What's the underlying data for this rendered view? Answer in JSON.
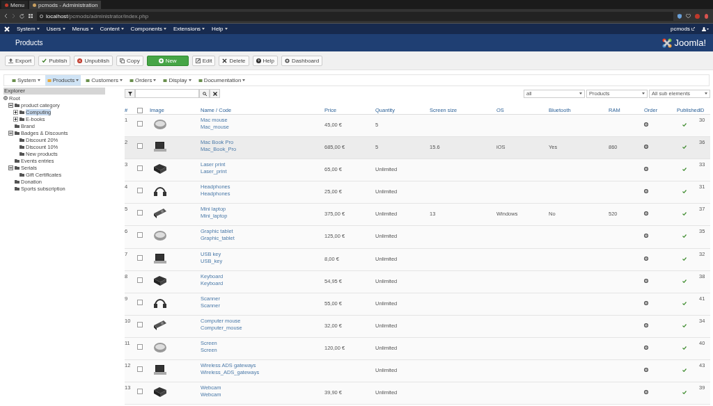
{
  "browser": {
    "tabs": [
      {
        "label": "Menu",
        "selected": false
      },
      {
        "label": "pcmods - Administration",
        "selected": true
      }
    ],
    "url_host": "localhost",
    "url_path": "/pcmods/administrator/index.php"
  },
  "nav": {
    "items": [
      "System",
      "Users",
      "Menus",
      "Content",
      "Components",
      "Extensions",
      "Help"
    ],
    "user": "pcmods"
  },
  "header": {
    "title": "Products",
    "logo": "Joomla!"
  },
  "toolbar": [
    {
      "label": "Export",
      "kind": "export"
    },
    {
      "label": "Publish",
      "kind": "publish"
    },
    {
      "label": "Unpublish",
      "kind": "unpublish"
    },
    {
      "label": "Copy",
      "kind": "copy"
    },
    {
      "label": "New",
      "kind": "new"
    },
    {
      "label": "Edit",
      "kind": "edit"
    },
    {
      "label": "Delete",
      "kind": "delete"
    },
    {
      "label": "Help",
      "kind": "help"
    },
    {
      "label": "Dashboard",
      "kind": "dashboard"
    }
  ],
  "submenu": [
    {
      "label": "System",
      "selected": false
    },
    {
      "label": "Products",
      "selected": true
    },
    {
      "label": "Customers",
      "selected": false
    },
    {
      "label": "Orders",
      "selected": false
    },
    {
      "label": "Display",
      "selected": false
    },
    {
      "label": "Documentation",
      "selected": false
    }
  ],
  "explorer": {
    "title": "Explorer",
    "tree": [
      {
        "label": "Root",
        "selected": false,
        "children": [
          {
            "label": "product category",
            "selected": false,
            "expanded": true,
            "children": [
              {
                "label": "Computing",
                "selected": true,
                "expanded": false
              },
              {
                "label": "E-books",
                "selected": false,
                "expanded": false
              }
            ]
          },
          {
            "label": "Brand",
            "selected": false
          },
          {
            "label": "Badges & Discounts",
            "selected": false,
            "expanded": true,
            "children": [
              {
                "label": "Discount 20%",
                "selected": false
              },
              {
                "label": "Discount 10%",
                "selected": false
              },
              {
                "label": "New products",
                "selected": false
              }
            ]
          },
          {
            "label": "Events entries",
            "selected": false
          },
          {
            "label": "Serials",
            "selected": false,
            "expanded": true,
            "children": [
              {
                "label": "Gift Certificates",
                "selected": false
              }
            ]
          },
          {
            "label": "Donation",
            "selected": false
          },
          {
            "label": "Sports subscription",
            "selected": false
          }
        ]
      }
    ]
  },
  "filters": {
    "selects": [
      "all",
      "Products",
      "All sub elements"
    ]
  },
  "table": {
    "select_all": {
      "checked": false
    },
    "columns": [
      "#",
      "Image",
      "Name / Code",
      "Price",
      "Quantity",
      "Screen size",
      "OS",
      "Bluetooth",
      "RAM",
      "Order",
      "Published",
      "ID"
    ],
    "rows": [
      {
        "num": "1",
        "checked": false,
        "selected": false,
        "name": "Mac mouse",
        "code": "Mac_mouse",
        "price": "45,00 €",
        "quantity": "5",
        "published": true,
        "id": "30"
      },
      {
        "num": "2",
        "checked": false,
        "selected": true,
        "name": "Mac Book Pro",
        "code": "Mac_Book_Pro",
        "price": "685,00 €",
        "quantity": "5",
        "screen_size": "15.6",
        "os": "iOS",
        "bluetooth": "Yes",
        "ram": "860",
        "published": true,
        "id": "36"
      },
      {
        "num": "3",
        "checked": false,
        "selected": false,
        "name": "Laser print",
        "code": "Laser_print",
        "price": "65,00 €",
        "quantity": "Unlimited",
        "published": true,
        "id": "33"
      },
      {
        "num": "4",
        "checked": false,
        "selected": false,
        "name": "Headphones",
        "code": "Headphones",
        "price": "25,00 €",
        "quantity": "Unlimited",
        "published": true,
        "id": "31"
      },
      {
        "num": "5",
        "checked": false,
        "selected": false,
        "name": "Mini laptop",
        "code": "Mini_laptop",
        "price": "375,00 €",
        "quantity": "Unlimited",
        "screen_size": "13",
        "os": "Windows",
        "bluetooth": "No",
        "ram": "520",
        "published": true,
        "id": "37"
      },
      {
        "num": "6",
        "checked": false,
        "selected": false,
        "name": "Graphic tablet",
        "code": "Graphic_tablet",
        "price": "125,00 €",
        "quantity": "Unlimited",
        "published": true,
        "id": "35"
      },
      {
        "num": "7",
        "checked": false,
        "selected": false,
        "name": "USB key",
        "code": "USB_key",
        "price": "8,00 €",
        "quantity": "Unlimited",
        "published": true,
        "id": "32"
      },
      {
        "num": "8",
        "checked": false,
        "selected": false,
        "name": "Keyboard",
        "code": "Keyboard",
        "price": "54,95 €",
        "quantity": "Unlimited",
        "published": true,
        "id": "38"
      },
      {
        "num": "9",
        "checked": false,
        "selected": false,
        "name": "Scanner",
        "code": "Scanner",
        "price": "55,00 €",
        "quantity": "Unlimited",
        "published": true,
        "id": "41"
      },
      {
        "num": "10",
        "checked": false,
        "selected": false,
        "name": "Computer mouse",
        "code": "Computer_mouse",
        "price": "32,00 €",
        "quantity": "Unlimited",
        "published": true,
        "id": "34"
      },
      {
        "num": "11",
        "checked": false,
        "selected": false,
        "name": "Screen",
        "code": "Screen",
        "price": "120,00 €",
        "quantity": "Unlimited",
        "published": true,
        "id": "40"
      },
      {
        "num": "12",
        "checked": false,
        "selected": false,
        "name": "Wireless ADS gateways",
        "code": "Wireless_ADS_gateways",
        "quantity": "Unlimited",
        "published": true,
        "id": "43"
      },
      {
        "num": "13",
        "checked": false,
        "selected": false,
        "name": "Webcam",
        "code": "Webcam",
        "price": "39,90 €",
        "quantity": "Unlimited",
        "published": true,
        "id": "39"
      }
    ]
  }
}
